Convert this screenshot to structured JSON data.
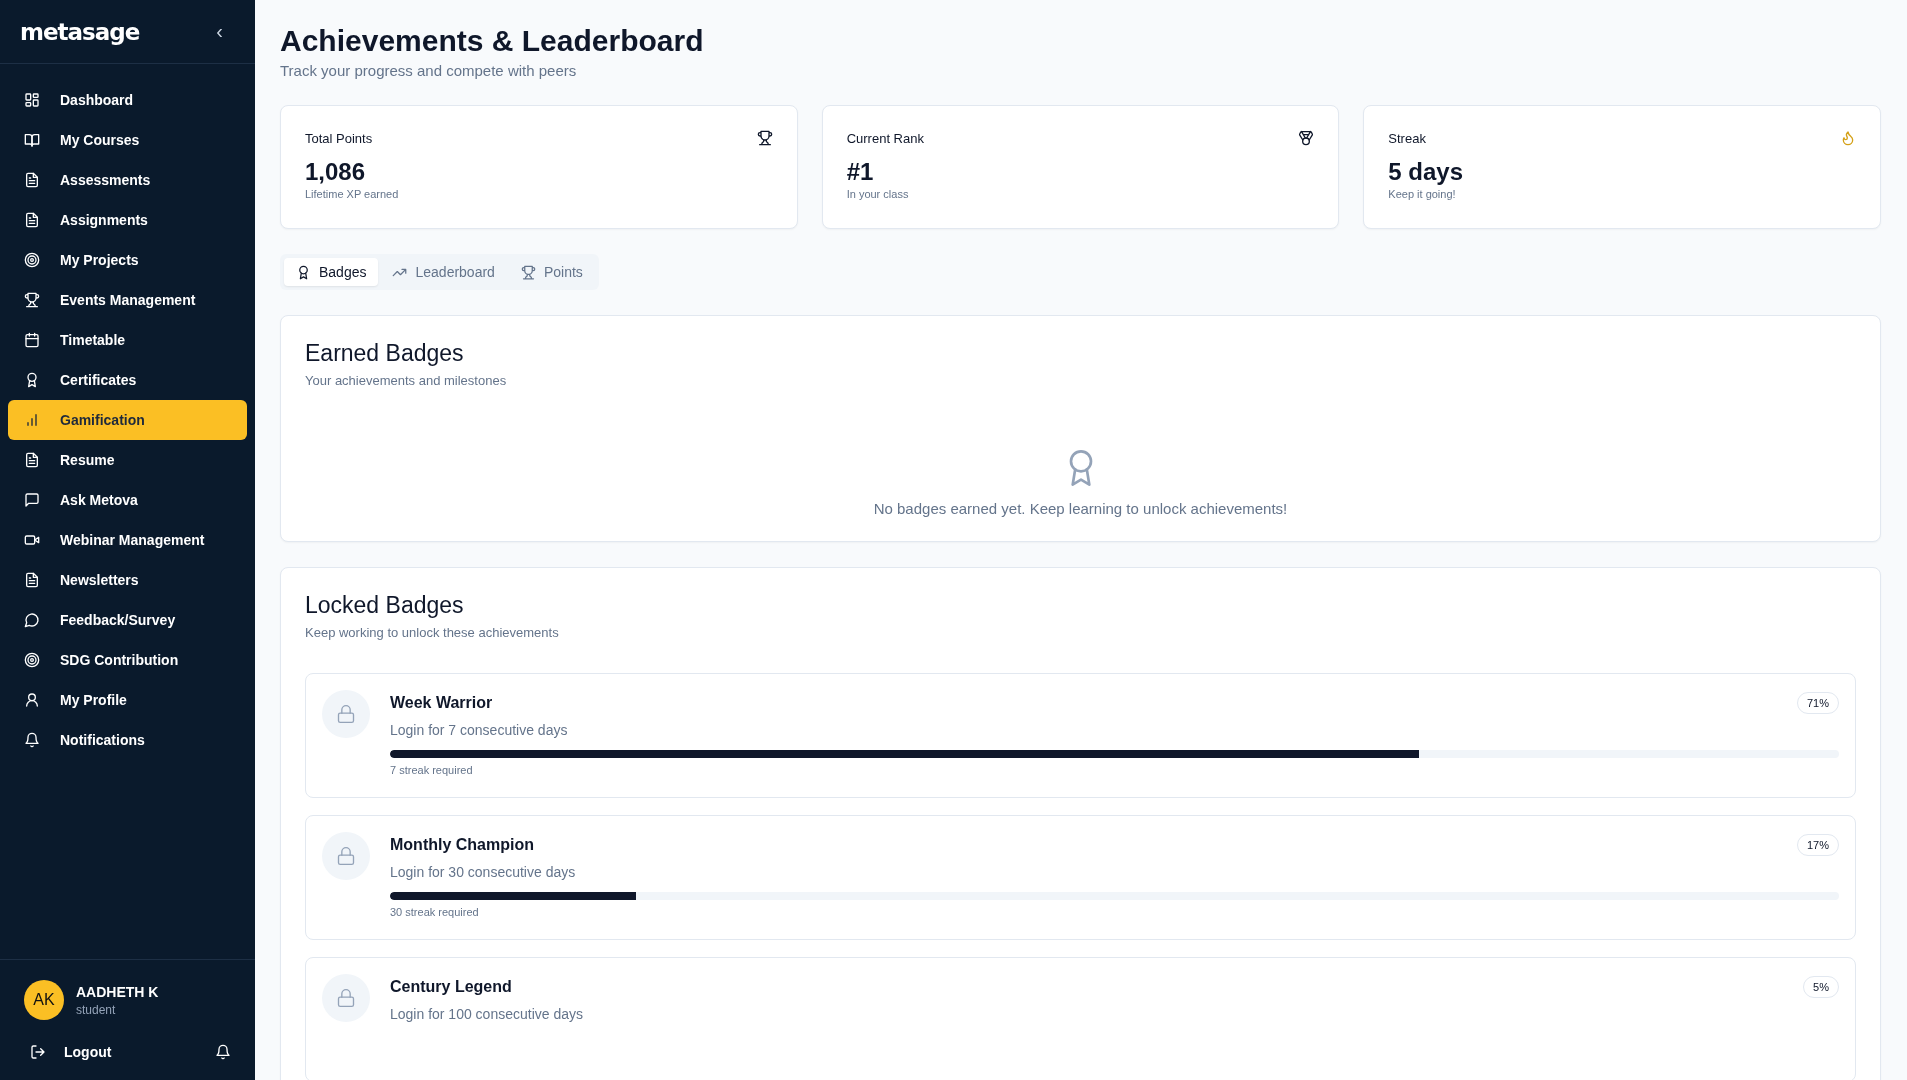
{
  "sidebar": {
    "logo": "metasage",
    "collapse": "‹",
    "items": [
      {
        "label": "Dashboard",
        "selected": false
      },
      {
        "label": "My Courses",
        "selected": false
      },
      {
        "label": "Assessments",
        "selected": false
      },
      {
        "label": "Assignments",
        "selected": false
      },
      {
        "label": "My Projects",
        "selected": false
      },
      {
        "label": "Events Management",
        "selected": false
      },
      {
        "label": "Timetable",
        "selected": false
      },
      {
        "label": "Certificates",
        "selected": false
      },
      {
        "label": "Gamification",
        "selected": true
      },
      {
        "label": "Resume",
        "selected": false
      },
      {
        "label": "Ask Metova",
        "selected": false
      },
      {
        "label": "Webinar Management",
        "selected": false
      },
      {
        "label": "Newsletters",
        "selected": false
      },
      {
        "label": "Feedback/Survey",
        "selected": false
      },
      {
        "label": "SDG Contribution",
        "selected": false
      },
      {
        "label": "My Profile",
        "selected": false
      },
      {
        "label": "Notifications",
        "selected": false
      }
    ],
    "user": {
      "initials": "AK",
      "name": "AADHETH K",
      "role": "student"
    },
    "logout": "Logout"
  },
  "page": {
    "title": "Achievements & Leaderboard",
    "subtitle": "Track your progress and compete with peers"
  },
  "stats": [
    {
      "label": "Total Points",
      "value": "1,086",
      "note": "Lifetime XP earned",
      "kind": "trophy"
    },
    {
      "label": "Current Rank",
      "value": "#1",
      "note": "In your class",
      "kind": "medal"
    },
    {
      "label": "Streak",
      "value": "5 days",
      "note": "Keep it going!",
      "kind": "flame"
    }
  ],
  "tabs": [
    {
      "label": "Badges",
      "selected": true
    },
    {
      "label": "Leaderboard",
      "selected": false
    },
    {
      "label": "Points",
      "selected": false
    }
  ],
  "earned": {
    "title": "Earned Badges",
    "subtitle": "Your achievements and milestones",
    "empty": "No badges earned yet. Keep learning to unlock achievements!"
  },
  "locked": {
    "title": "Locked Badges",
    "subtitle": "Keep working to unlock these achievements",
    "badges": [
      {
        "name": "Week Warrior",
        "description": "Login for 7 consecutive days",
        "percent": "71%",
        "level": 0.71,
        "requirement": "7 streak required"
      },
      {
        "name": "Monthly Champion",
        "description": "Login for 30 consecutive days",
        "percent": "17%",
        "level": 0.17,
        "requirement": "30 streak required"
      },
      {
        "name": "Century Legend",
        "description": "Login for 100 consecutive days",
        "percent": "5%"
      }
    ]
  }
}
